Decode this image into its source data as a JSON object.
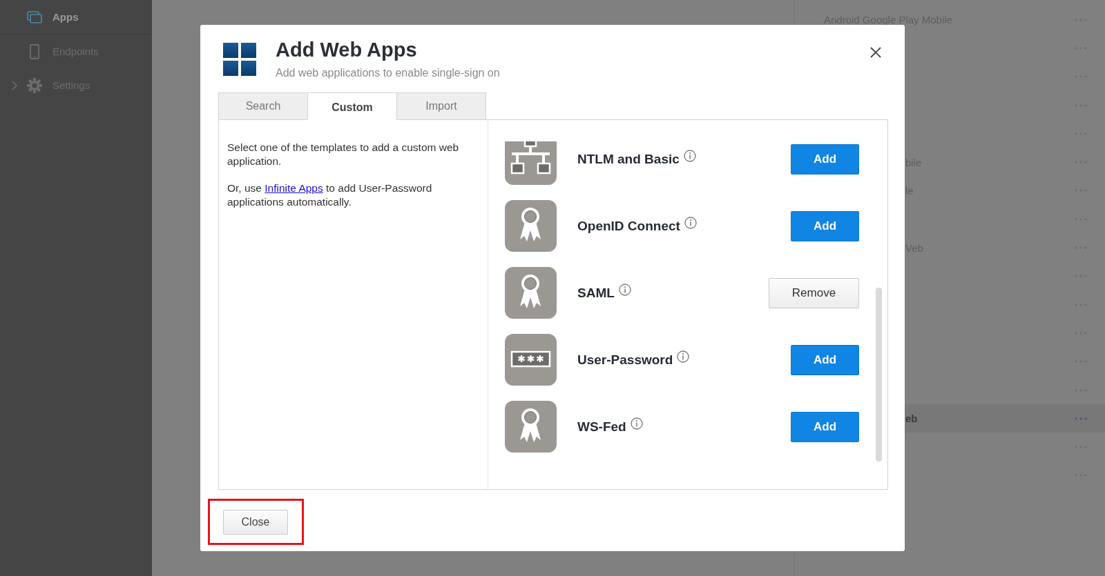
{
  "sidebar": {
    "items": [
      {
        "label": "Apps",
        "selected": true,
        "expandable": false
      },
      {
        "label": "Endpoints",
        "selected": false,
        "expandable": false
      },
      {
        "label": "Settings",
        "selected": false,
        "expandable": true
      }
    ]
  },
  "background_list": {
    "rows": [
      {
        "name": "Android Google Play Mobile",
        "selected": false
      },
      {
        "selected": false
      },
      {
        "selected": false
      },
      {
        "selected": false
      },
      {
        "selected": false
      },
      {
        "name": "bile",
        "partly_covered": true,
        "selected": false
      },
      {
        "name": "le",
        "partly_covered": true,
        "selected": false
      },
      {
        "selected": false
      },
      {
        "name": "Veb",
        "partly_covered": true,
        "selected": false
      },
      {
        "selected": false
      },
      {
        "selected": false
      },
      {
        "selected": false
      },
      {
        "selected": false
      },
      {
        "selected": false
      },
      {
        "name": "eb",
        "partly_covered": true,
        "selected": true
      },
      {
        "selected": false
      },
      {
        "selected": false
      }
    ]
  },
  "dialog": {
    "title": "Add Web Apps",
    "subtitle": "Add web applications to enable single-sign on",
    "tabs": [
      {
        "label": "Search",
        "selected": false
      },
      {
        "label": "Custom",
        "selected": true
      },
      {
        "label": "Import",
        "selected": false
      }
    ],
    "description": [
      {
        "text": "Select one of the templates to add a custom web application."
      },
      {
        "before": "Or, use",
        "link": "Infinite Apps",
        "after": "to add User-Password applications automatically."
      }
    ],
    "templates": [
      {
        "name": "NTLM and Basic",
        "kind": "network",
        "action": "Add",
        "added": false
      },
      {
        "name": "OpenID Connect",
        "kind": "certificate",
        "action": "Add",
        "added": false
      },
      {
        "name": "SAML",
        "kind": "certificate",
        "action": "Remove",
        "added": true
      },
      {
        "name": "User-Password",
        "kind": "password",
        "action": "Add",
        "added": false
      },
      {
        "name": "WS-Fed",
        "kind": "certificate",
        "action": "Add",
        "added": false
      }
    ],
    "close_button": {
      "label": "Close",
      "highlighted": true
    }
  }
}
